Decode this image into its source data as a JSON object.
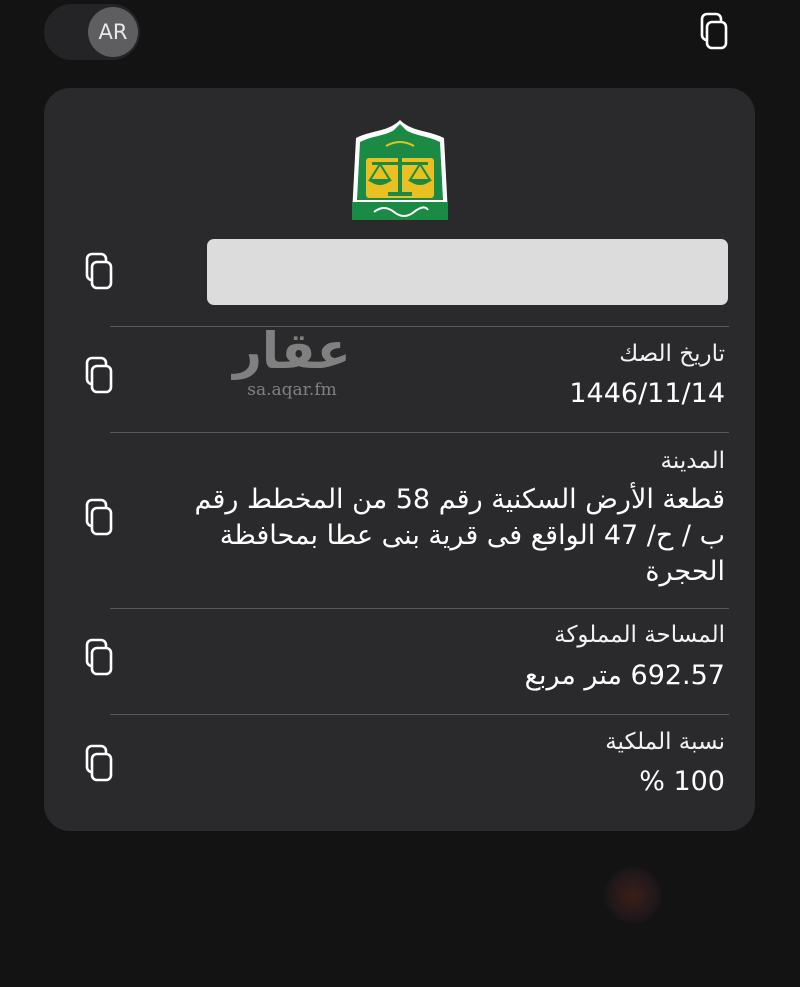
{
  "header": {
    "language_code": "AR"
  },
  "watermark": {
    "arabic": "عقار",
    "latin": "sa.aqar.fm"
  },
  "deed": {
    "fields": [
      {
        "label": "تاريخ الصك",
        "value": "1446/11/14"
      },
      {
        "label": "المدينة",
        "value": "قطعة الأرض السكنية رقم 58 من المخطط رقم ب / ح/ 47 الواقع فى قرية بنى عطا بمحافظة الحجرة"
      },
      {
        "label": "المساحة المملوكة",
        "value": "692.57 متر مربع"
      },
      {
        "label": "نسبة الملكية",
        "value": "100 %"
      }
    ]
  },
  "colors": {
    "background": "#131314",
    "card": "#2a2a2c",
    "logo_green": "#1a8a45",
    "logo_gold": "#e8c022"
  },
  "icons": {
    "copy": "copy-icon",
    "logo": "ministry-of-justice-logo"
  }
}
